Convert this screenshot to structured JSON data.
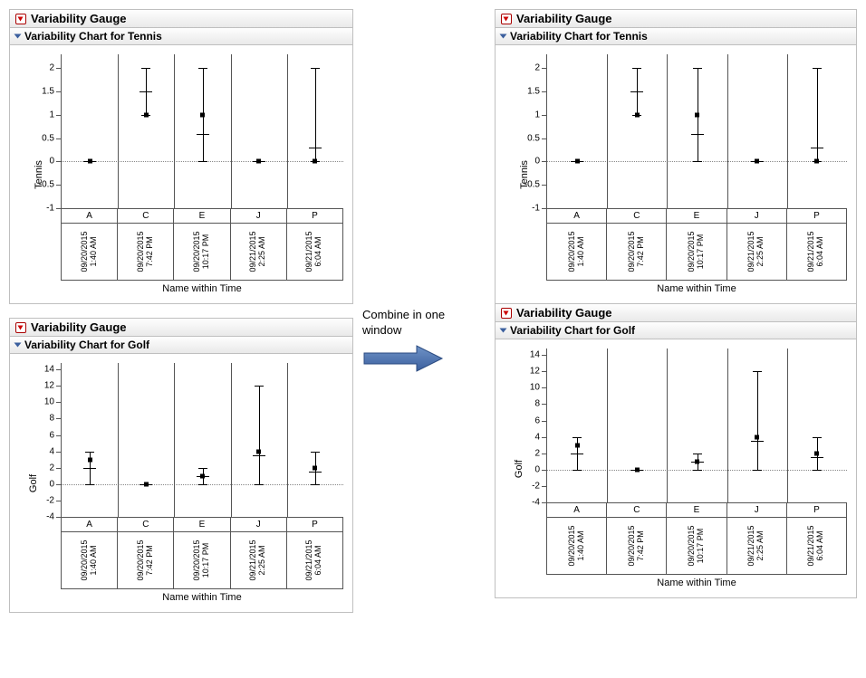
{
  "combine_label": "Combine in one window",
  "panels": {
    "tennis": {
      "gauge_title": "Variability Gauge",
      "chart_title": "Variability Chart for Tennis",
      "ylabel": "Tennis",
      "xlabel": "Name within Time"
    },
    "golf": {
      "gauge_title": "Variability Gauge",
      "chart_title": "Variability Chart for Golf",
      "ylabel": "Golf",
      "xlabel": "Name within Time"
    }
  },
  "categories": [
    "A",
    "C",
    "E",
    "J",
    "P"
  ],
  "times": [
    {
      "date": "09/20/2015",
      "time": "1:40 AM"
    },
    {
      "date": "09/20/2015",
      "time": "7:42 PM"
    },
    {
      "date": "09/20/2015",
      "time": "10:17 PM"
    },
    {
      "date": "09/21/2015",
      "time": "2:25 AM"
    },
    {
      "date": "09/21/2015",
      "time": "6:04 AM"
    }
  ],
  "chart_data": [
    {
      "id": "tennis",
      "type": "variability",
      "title": "Variability Chart for Tennis",
      "ylabel": "Tennis",
      "xlabel": "Name within Time",
      "yticks": [
        -1,
        -0.5,
        0,
        0.5,
        1,
        1.5,
        2
      ],
      "ylim": [
        -1,
        2.3
      ],
      "zero_at": 0,
      "categories": [
        "A",
        "C",
        "E",
        "J",
        "P"
      ],
      "series": [
        {
          "cat": "A",
          "min": 0,
          "max": 0,
          "mean": 0,
          "median": 0
        },
        {
          "cat": "C",
          "min": 1,
          "max": 2,
          "mean": 1.5,
          "median": 1
        },
        {
          "cat": "E",
          "min": 0,
          "max": 2,
          "mean": 0.6,
          "median": 1
        },
        {
          "cat": "J",
          "min": 0,
          "max": 0,
          "mean": 0,
          "median": 0
        },
        {
          "cat": "P",
          "min": 0,
          "max": 2,
          "mean": 0.3,
          "median": 0
        }
      ]
    },
    {
      "id": "golf",
      "type": "variability",
      "title": "Variability Chart for Golf",
      "ylabel": "Golf",
      "xlabel": "Name within Time",
      "yticks": [
        -4,
        -2,
        0,
        2,
        4,
        6,
        8,
        10,
        12,
        14
      ],
      "ylim": [
        -4,
        14.8
      ],
      "zero_at": 0,
      "categories": [
        "A",
        "C",
        "E",
        "J",
        "P"
      ],
      "series": [
        {
          "cat": "A",
          "min": 0,
          "max": 4,
          "mean": 2,
          "median": 3
        },
        {
          "cat": "C",
          "min": 0,
          "max": 0,
          "mean": 0,
          "median": 0
        },
        {
          "cat": "E",
          "min": 0,
          "max": 2,
          "mean": 1,
          "median": 1
        },
        {
          "cat": "J",
          "min": 0,
          "max": 12,
          "mean": 3.5,
          "median": 4
        },
        {
          "cat": "P",
          "min": 0,
          "max": 4,
          "mean": 1.5,
          "median": 2
        }
      ]
    }
  ]
}
